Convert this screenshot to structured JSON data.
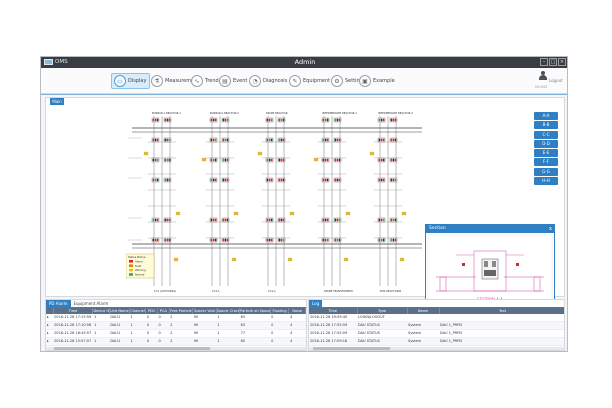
{
  "app": {
    "name": "OMS",
    "title": "Admin"
  },
  "toolbar": {
    "items": [
      {
        "key": "display",
        "label": "Display",
        "icon": "monitor-icon",
        "glyph": "▭",
        "active": true
      },
      {
        "key": "measurement",
        "label": "Measurement",
        "icon": "measurement-icon",
        "glyph": "⚗"
      },
      {
        "key": "trend",
        "label": "Trend",
        "icon": "trend-icon",
        "glyph": "∿"
      },
      {
        "key": "event",
        "label": "Event",
        "icon": "event-icon",
        "glyph": "▤"
      },
      {
        "key": "diagnosis",
        "label": "Diagnosis",
        "icon": "diagnosis-icon",
        "glyph": "◔"
      },
      {
        "key": "equipment",
        "label": "Equipment",
        "icon": "equipment-icon",
        "glyph": "✎"
      },
      {
        "key": "setting",
        "label": "Setting",
        "icon": "gear-icon",
        "glyph": "⚙"
      },
      {
        "key": "example",
        "label": "Example",
        "icon": "example-icon",
        "glyph": "▣"
      }
    ],
    "logout_label": "Logout",
    "user_name": "MUUSE"
  },
  "main": {
    "tab_label": "Main",
    "zones": [
      "A-A",
      "B-B",
      "C-C",
      "D-D",
      "E-E",
      "F-F",
      "G-G",
      "H-H"
    ],
    "section_title": "Section",
    "section_close": "x",
    "section_caption": "SECTION A-A"
  },
  "diagram": {
    "bus_labels": [
      "BUSBAR-1  REACTOR-1",
      "BUSBAR-2  REACTOR-2",
      "SPARE REACTOR",
      "INTERMEDIATE REACTOR-1",
      "INTERMEDIATE REACTOR-2"
    ],
    "bottom_labels": [
      "1C1 (OUTGOING)",
      "1C2-1",
      "1C2-2",
      "SPARE TRANSFORMER",
      "BUS REACTOR-B"
    ],
    "legend_title": "Status Notice",
    "legend_items": [
      "Alarm",
      "Fault",
      "Warning",
      "Normal"
    ]
  },
  "alarm": {
    "tabs": [
      "PD Alarm",
      "Equipment Alarm"
    ],
    "columns": [
      "",
      "Time",
      "Device ID",
      "Unit Name",
      "Channel",
      "PDC",
      "PCA",
      "Free Particle",
      "Spacer Void",
      "Spacer Crack",
      "Particle on Spacer",
      "Floating",
      "Noise"
    ],
    "rows": [
      [
        "▸",
        "2016-11-28 17:15:59",
        "1",
        "DAU1",
        "1",
        "0",
        "0",
        "2",
        "90",
        "1",
        "83",
        "0",
        "4"
      ],
      [
        "▸",
        "2016-11-28 17:10:56",
        "1",
        "DAU1",
        "1",
        "0",
        "0",
        "2",
        "90",
        "1",
        "83",
        "0",
        "4"
      ],
      [
        "▸",
        "2016-11-28 16:45:57",
        "1",
        "DAU1",
        "1",
        "0",
        "0",
        "2",
        "90",
        "1",
        "77",
        "0",
        "4"
      ],
      [
        "▸",
        "2016-11-28 15:57:57",
        "1",
        "DAU1",
        "1",
        "0",
        "0",
        "2",
        "90",
        "1",
        "85",
        "0",
        "4"
      ]
    ]
  },
  "log": {
    "tabs": [
      "Log"
    ],
    "columns": [
      "Time",
      "Type",
      "Name",
      "Text"
    ],
    "rows": [
      [
        "2016-11-28 19:59:40",
        "LOGIN/LOGOUT",
        "",
        ""
      ],
      [
        "2016-11-28 17:55:59",
        "DAU STATUS",
        "System",
        "DAU 1_PRPD"
      ],
      [
        "2016-11-28 17:55:09",
        "DAU STATUS",
        "System",
        "DAU 1_PRPD"
      ],
      [
        "2016-11-28 17:09:18",
        "DAU STATUS",
        "System",
        "DAU 1_PRPD"
      ]
    ]
  },
  "colors": {
    "accent": "#2f7fc4",
    "header": "#5a6f8a",
    "titlebar": "#3a3d42",
    "alarm_red": "#d8262b",
    "normal_green": "#39a84a",
    "warn_yellow": "#e8c020"
  }
}
